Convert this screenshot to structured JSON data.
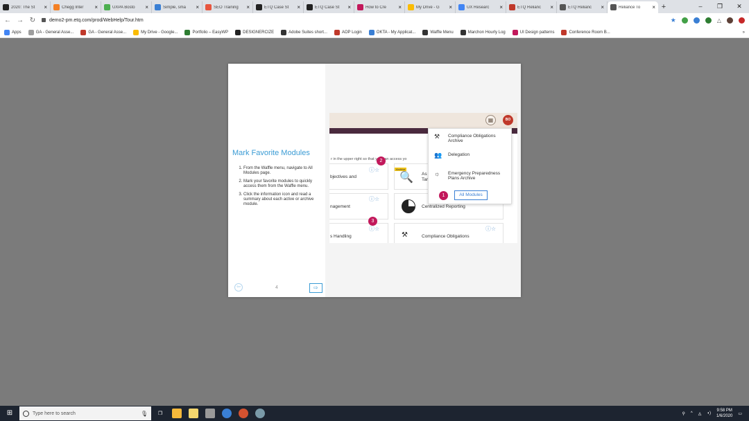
{
  "browser": {
    "tabs": [
      {
        "label": "2020: The St",
        "color": "#222222"
      },
      {
        "label": "Chegg Inter",
        "color": "#f48024"
      },
      {
        "label": "UXPA Bosto",
        "color": "#4caf50"
      },
      {
        "label": "Simple, sma",
        "color": "#3a7fd4"
      },
      {
        "label": "SEO Training",
        "color": "#e8563f"
      },
      {
        "label": "ETQ Case St",
        "color": "#222222"
      },
      {
        "label": "ETQ Case St",
        "color": "#222222"
      },
      {
        "label": "How to Cre",
        "color": "#c2185b"
      },
      {
        "label": "My Drive - G",
        "color": "#fbbc04"
      },
      {
        "label": "UX Researc",
        "color": "#4285f4"
      },
      {
        "label": "ETQ Relianc",
        "color": "#c0392b"
      },
      {
        "label": "ETQ Relianc",
        "color": "#555555"
      },
      {
        "label": "Reliance To",
        "color": "#555555",
        "active": true
      }
    ],
    "tab_close": "×",
    "new_tab": "+",
    "window_controls": {
      "minimize": "–",
      "maximize": "❐",
      "close": "✕"
    },
    "url": "demo2-pm.etq.com/prod/WebHelp/Tour.htm",
    "bookmarks": [
      {
        "label": "Apps",
        "color": "#4285f4"
      },
      {
        "label": "GA - General Asse...",
        "color": "#9e9e9e"
      },
      {
        "label": "GA - General Asse...",
        "color": "#c0392b"
      },
      {
        "label": "My Drive - Google...",
        "color": "#fbbc04"
      },
      {
        "label": "Portfolio – EasyWP",
        "color": "#2e7d32"
      },
      {
        "label": "DESIGNERCIZE",
        "color": "#222222"
      },
      {
        "label": "Adobe Suites short...",
        "color": "#333333"
      },
      {
        "label": "AOP Login",
        "color": "#c0392b"
      },
      {
        "label": "OKTA - My Applicat...",
        "color": "#3a7fd4"
      },
      {
        "label": "Waffle Menu",
        "color": "#333333"
      },
      {
        "label": "Marchon Hourly Log",
        "color": "#333333"
      },
      {
        "label": "UI Design patterns",
        "color": "#c2185b"
      },
      {
        "label": "Conference Room B...",
        "color": "#c0392b"
      }
    ],
    "bookmarks_more": "»"
  },
  "slide": {
    "title": "Mark Favorite Modules",
    "steps": [
      "From the Waffle menu, navigate to All Modules page.",
      "Mark your favorite modules to quickly access them from the Waffle menu.",
      "Click the information icon and read a summary about each active or archive module."
    ],
    "page_number": "4",
    "prev_symbol": "⇦",
    "next_symbol": "⇨"
  },
  "app": {
    "avatar_initials": "BO",
    "intro_text": "r in the upper right so that you can access yo",
    "archive_label": "Archive",
    "cards": [
      {
        "text": "bjectives and"
      },
      {
        "text": "As\nTar"
      },
      {
        "text": "nagement"
      },
      {
        "text": "Centralized Reporting"
      },
      {
        "text": "s Handling"
      },
      {
        "text": "Compliance Obligations"
      }
    ],
    "card_icons": "ⓘ☆",
    "badges": [
      "1",
      "2",
      "3"
    ],
    "dropdown": {
      "items": [
        {
          "label": "Compliance Obligations Archive",
          "icon": "gavel-icon"
        },
        {
          "label": "Delegation",
          "icon": "people-icon"
        },
        {
          "label": "Emergency Preparedness Plans Archive",
          "icon": "siren-icon"
        }
      ],
      "all_modules_label": "All Modules"
    }
  },
  "taskbar": {
    "search_placeholder": "Type here to search",
    "time": "9:58 PM",
    "date": "1/6/2020"
  },
  "colors": {
    "accent_blue": "#3a9bd4",
    "badge_pink": "#c2185b",
    "header_beige": "#efe6dd",
    "purple_bar": "#4a2a3e",
    "avatar_red": "#c0392b"
  }
}
